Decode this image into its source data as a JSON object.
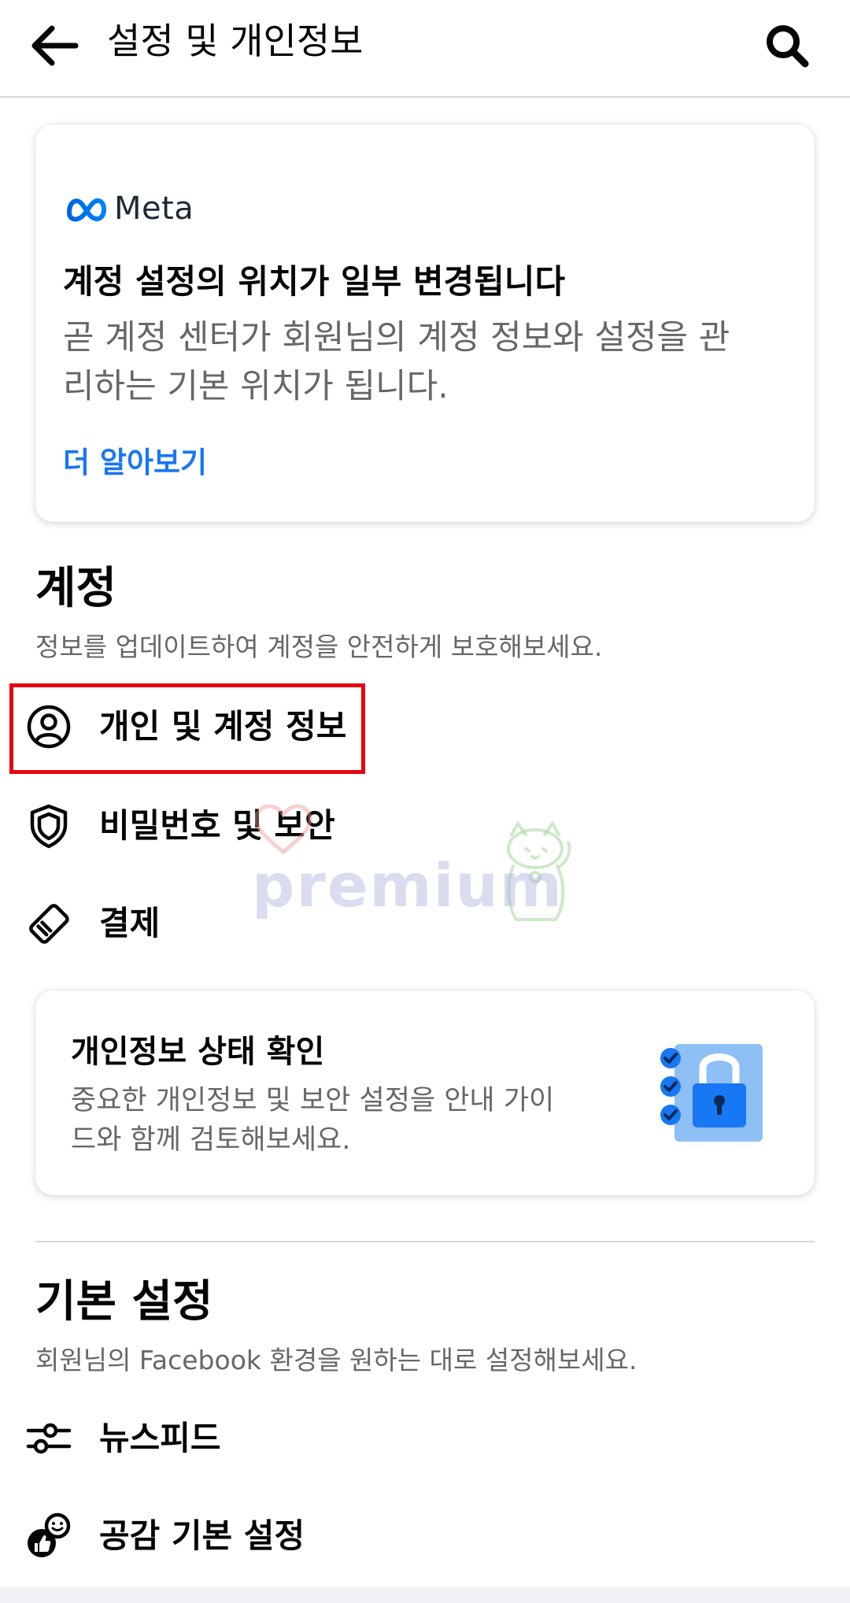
{
  "header": {
    "title": "설정 및 개인정보",
    "back_icon": "arrow-left-icon",
    "search_icon": "search-icon"
  },
  "meta_card": {
    "logo_text": "Meta",
    "title": "계정 설정의 위치가 일부 변경됩니다",
    "description": "곧 계정 센터가 회원님의 계정 정보와 설정을 관리하는 기본 위치가 됩니다.",
    "link": "더 알아보기"
  },
  "account_section": {
    "title": "계정",
    "subtitle": "정보를 업데이트하여 계정을 안전하게 보호해보세요.",
    "items": [
      {
        "label": "개인 및 계정 정보",
        "icon": "user-circle-icon"
      },
      {
        "label": "비밀번호 및 보안",
        "icon": "shield-icon"
      },
      {
        "label": "결제",
        "icon": "payment-tag-icon"
      }
    ]
  },
  "privacy_card": {
    "title": "개인정보 상태 확인",
    "description": "중요한 개인정보 및 보안 설정을 안내 가이드와 함께 검토해보세요.",
    "icon": "privacy-checklist-lock-icon"
  },
  "preferences_section": {
    "title": "기본 설정",
    "subtitle": "회원님의 Facebook 환경을 원하는 대로 설정해보세요.",
    "items": [
      {
        "label": "뉴스피드",
        "icon": "sliders-icon"
      },
      {
        "label": "공감 기본 설정",
        "icon": "reactions-icon"
      }
    ]
  },
  "watermark": {
    "text": "premium"
  },
  "colors": {
    "accent": "#1877f2",
    "highlight": "#e30613",
    "secondary_text": "#65676b"
  }
}
